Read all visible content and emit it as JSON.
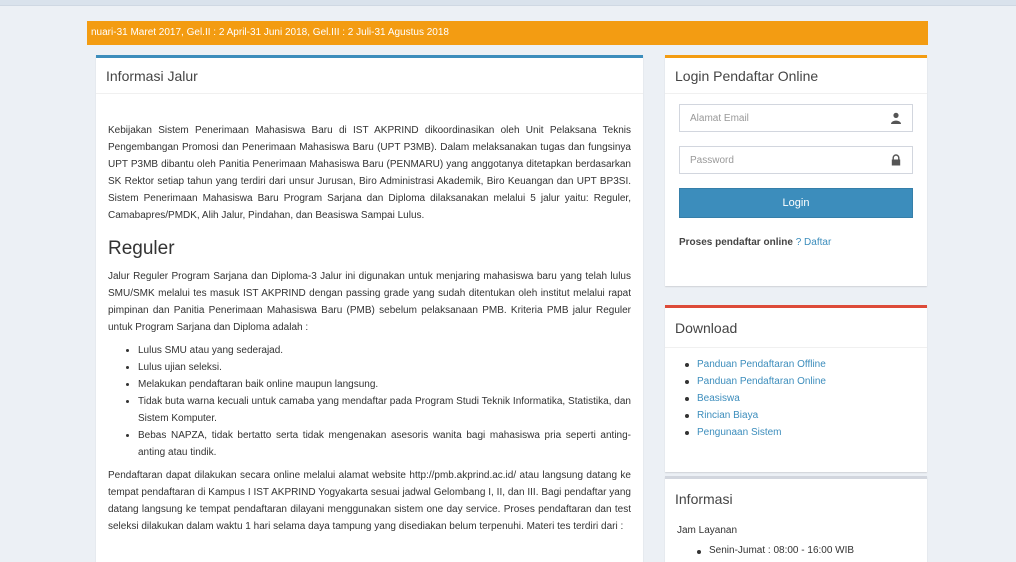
{
  "marquee": {
    "text": "nuari-31 Maret 2017, Gel.II : 2 April-31 Juni 2018, Gel.III : 2 Juli-31 Agustus 2018"
  },
  "info_jalur": {
    "title": "Informasi Jalur",
    "intro": "Kebijakan Sistem Penerimaan Mahasiswa Baru di IST AKPRIND dikoordinasikan oleh Unit Pelaksana Teknis Pengembangan Promosi dan Penerimaan Mahasiswa Baru (UPT P3MB). Dalam melaksanakan tugas dan fungsinya UPT P3MB dibantu oleh Panitia Penerimaan Mahasiswa Baru (PENMARU) yang anggotanya ditetapkan berdasarkan SK Rektor setiap tahun yang terdiri dari unsur Jurusan, Biro Administrasi Akademik, Biro Keuangan dan UPT BP3SI. Sistem Penerimaan Mahasiswa Baru Program Sarjana dan Diploma dilaksanakan melalui 5 jalur yaitu: Reguler, Camabapres/PMDK, Alih Jalur, Pindahan, dan Beasiswa Sampai Lulus.",
    "heading": "Reguler",
    "reguler_desc": "Jalur Reguler Program Sarjana dan Diploma-3 Jalur ini digunakan untuk menjaring mahasiswa baru yang telah lulus SMU/SMK melalui tes masuk IST AKPRIND dengan passing grade yang sudah ditentukan oleh institut melalui rapat pimpinan dan Panitia Penerimaan Mahasiswa Baru (PMB) sebelum pelaksanaan PMB. Kriteria PMB jalur Reguler untuk Program Sarjana dan Diploma adalah :",
    "criteria": [
      "Lulus SMU atau yang sederajad.",
      "Lulus ujian seleksi.",
      "Melakukan pendaftaran baik online maupun langsung.",
      "Tidak buta warna kecuali untuk camaba yang mendaftar pada Program Studi Teknik Informatika, Statistika, dan Sistem Komputer.",
      "Bebas NAPZA, tidak bertatto serta tidak mengenakan asesoris wanita bagi mahasiswa pria seperti anting-anting atau tindik."
    ],
    "pendaftaran": "Pendaftaran dapat dilakukan secara online melalui alamat website http://pmb.akprind.ac.id/ atau langsung datang ke tempat pendaftaran di Kampus I IST AKPRIND Yogyakarta sesuai jadwal Gelombang I, II, dan III. Bagi pendaftar yang datang langsung ke tempat pendaftaran dilayani menggunakan sistem one day service. Proses pendaftaran dan test seleksi dilakukan dalam waktu 1 hari selama daya tampung yang disediakan belum terpenuhi. Materi tes terdiri dari :"
  },
  "login": {
    "title": "Login Pendaftar Online",
    "email_placeholder": "Alamat Email",
    "password_placeholder": "Password",
    "button": "Login",
    "prompt_bold": "Proses pendaftar online",
    "prompt_sep": "?",
    "register_link": "Daftar"
  },
  "download": {
    "title": "Download",
    "items": [
      "Panduan Pendaftaran Offline",
      "Panduan Pendaftaran Online",
      "Beasiswa",
      "Rincian Biaya",
      "Pengunaan Sistem"
    ]
  },
  "informasi": {
    "title": "Informasi",
    "subtitle": "Jam Layanan",
    "items": [
      "Senin-Jumat : 08:00 - 16:00 WIB"
    ]
  },
  "colors": {
    "marquee": "#f39c12",
    "primary": "#3c8dbc",
    "danger": "#dd4b39"
  }
}
